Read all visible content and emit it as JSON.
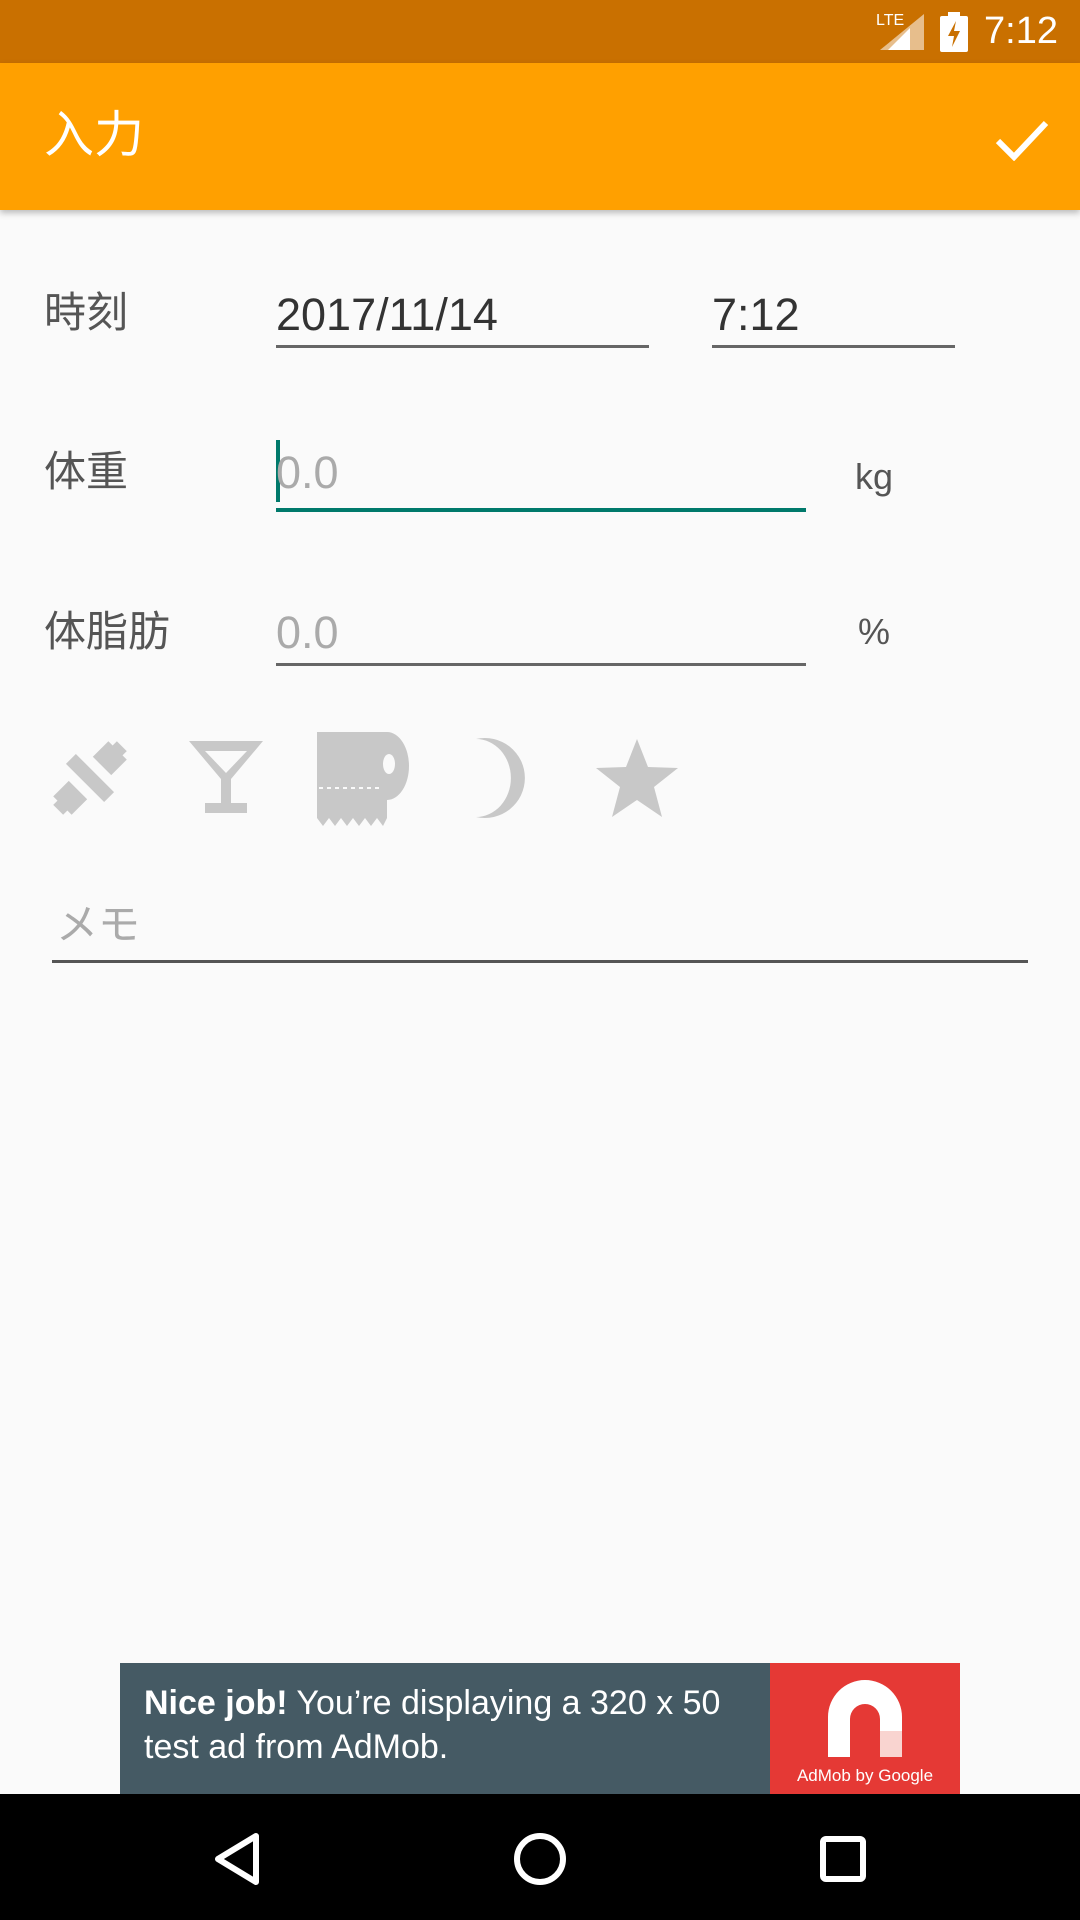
{
  "status_bar": {
    "network": "LTE",
    "time": "7:12"
  },
  "app_bar": {
    "title": "入力",
    "confirm_icon": "check-icon"
  },
  "form": {
    "time_row": {
      "label": "時刻",
      "date_value": "2017/11/14",
      "time_value": "7:12"
    },
    "weight_row": {
      "label": "体重",
      "placeholder": "0.0",
      "unit": "kg"
    },
    "body_fat_row": {
      "label": "体脂肪",
      "placeholder": "0.0",
      "unit": "%"
    },
    "tag_icons": [
      "dumbbell-icon",
      "cocktail-icon",
      "toilet-paper-icon",
      "moon-icon",
      "star-icon"
    ],
    "memo": {
      "placeholder": "メモ"
    }
  },
  "ad_banner": {
    "headline": "Nice job!",
    "body": " You’re displaying a 320 x 50 test ad from AdMob.",
    "logo_caption": "AdMob by Google"
  },
  "colors": {
    "status_bar": "#c97000",
    "app_bar": "#ffa000",
    "accent": "#00796b",
    "icon_inactive": "#c8c8c8"
  }
}
